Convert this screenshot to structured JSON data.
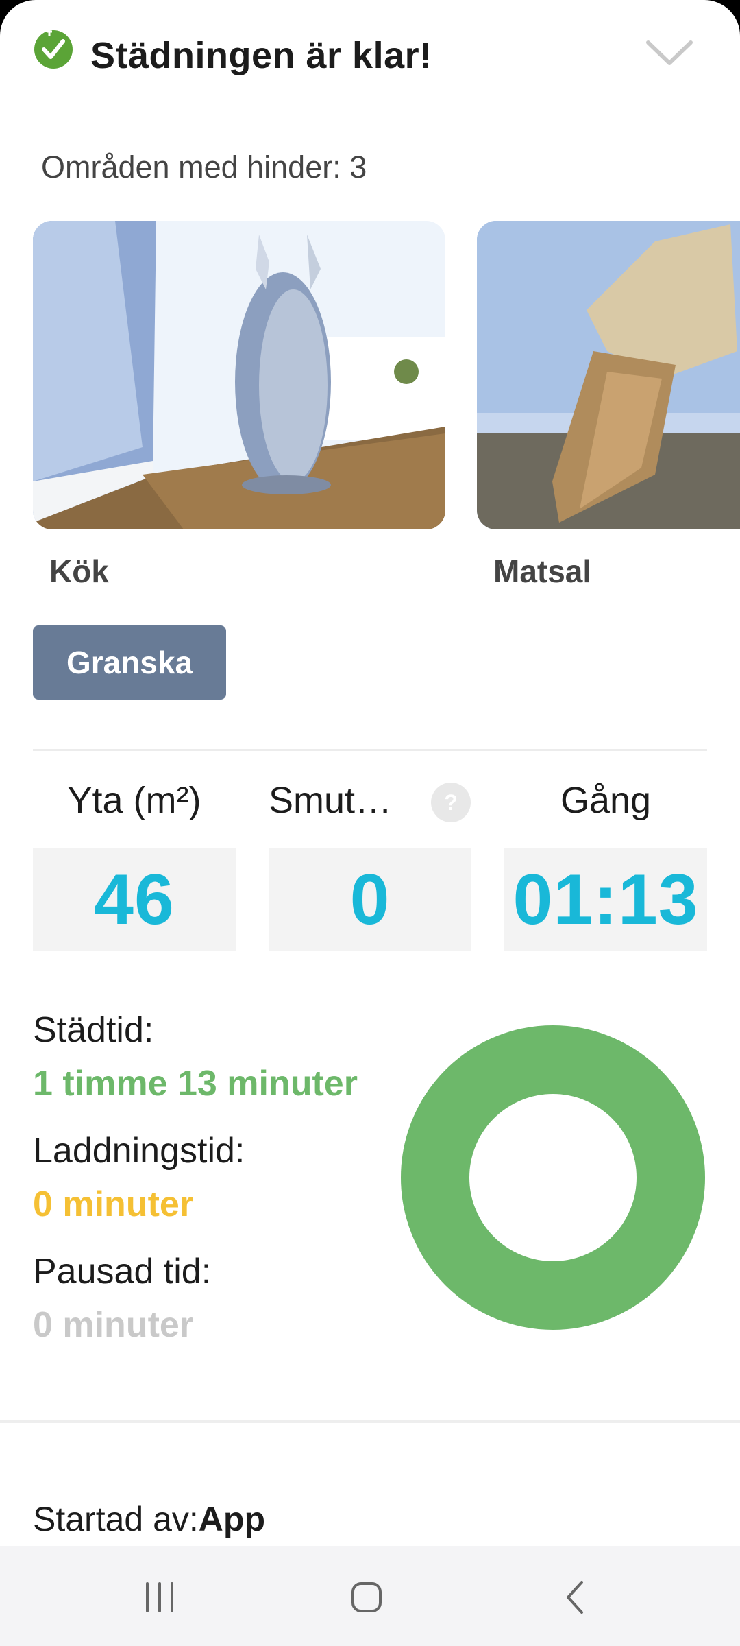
{
  "header": {
    "title": "Städningen är klar!",
    "status_icon": "check-clock-icon",
    "collapse_icon": "chevron-down-icon"
  },
  "obstacles": {
    "label": "Områden med hinder: 3",
    "items": [
      {
        "room": "Kök",
        "image": "obstacle-photo-kitchen"
      },
      {
        "room": "Matsal",
        "image": "obstacle-photo-dining"
      }
    ],
    "review_label": "Granska"
  },
  "stats": [
    {
      "header": "Yta (m²)",
      "value": "46"
    },
    {
      "header": "Smut…",
      "value": "0",
      "help_icon": "question-icon"
    },
    {
      "header": "Gång",
      "value": "01:13"
    }
  ],
  "times": {
    "cleaning": {
      "label": "Städtid:",
      "value": "1 timme 13 minuter",
      "color": "#6db86a"
    },
    "charging": {
      "label": "Laddningstid:",
      "value": "0 minuter",
      "color": "#f5c034"
    },
    "paused": {
      "label": "Pausad tid:",
      "value": "0 minuter",
      "color": "#c9c9c9"
    },
    "donut_fraction_cleaning": 1.0
  },
  "started": {
    "label": "Startad av:",
    "value": "App"
  },
  "navbar": {
    "recents": "recents-icon",
    "home": "home-icon",
    "back": "back-icon"
  },
  "colors": {
    "accent": "#19b8d8",
    "button": "#687b96",
    "green": "#6db86a",
    "yellow": "#f5c034"
  }
}
